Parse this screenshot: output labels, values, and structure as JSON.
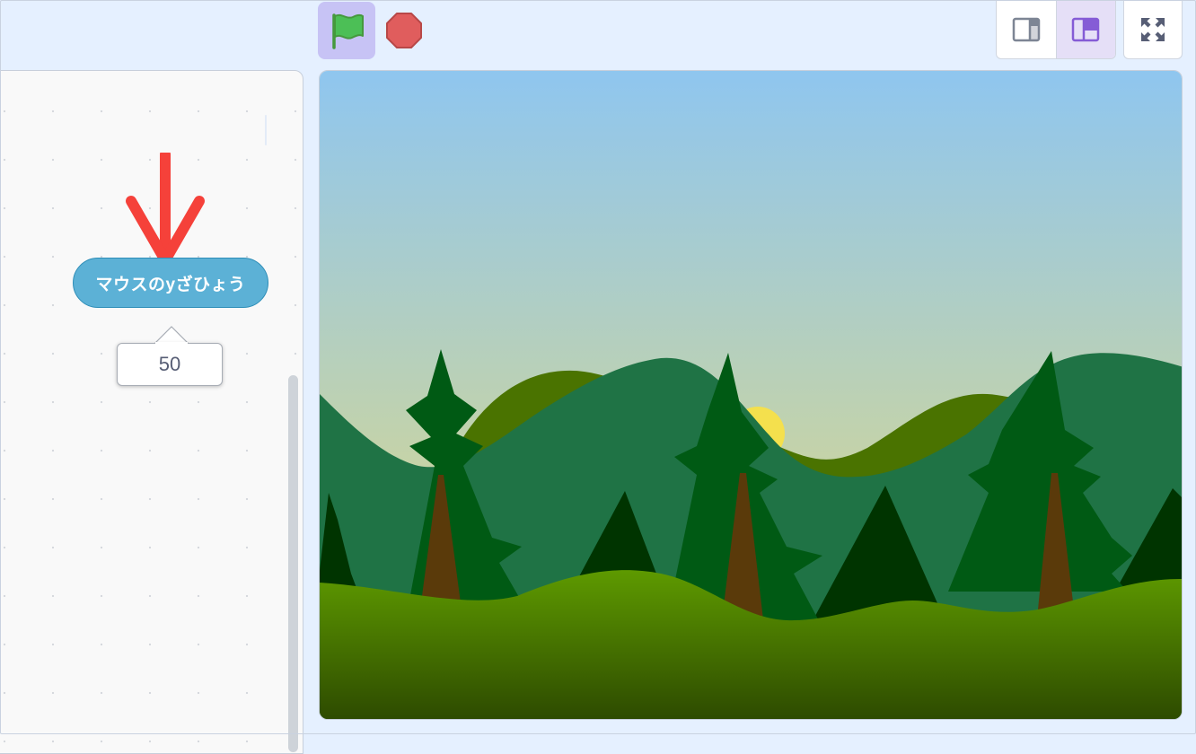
{
  "workspace": {
    "reporter_block": {
      "label": "マウスのyざひょう",
      "color": "#5cb1d6"
    },
    "value_bubble": {
      "value": "50"
    },
    "annotation_arrow": {
      "color": "#f5413a",
      "icon": "arrow-down-icon"
    }
  },
  "toolbar": {
    "green_flag": {
      "icon": "green-flag-icon",
      "color": "#4cbf56"
    },
    "stop": {
      "icon": "stop-sign-icon",
      "color": "#e05d5d"
    },
    "layout_buttons": [
      {
        "icon": "small-stage-icon",
        "active": false
      },
      {
        "icon": "large-stage-icon",
        "active": true
      }
    ],
    "fullscreen": {
      "icon": "fullscreen-icon"
    }
  },
  "stage": {
    "backdrop": "forest",
    "sky_colors": [
      "#8fc6ef",
      "#c9d4a3"
    ],
    "sun_color": "#f4e04d",
    "tree_color": "#005a14",
    "grass_colors": [
      "#5e9a00",
      "#2d4a00"
    ]
  }
}
